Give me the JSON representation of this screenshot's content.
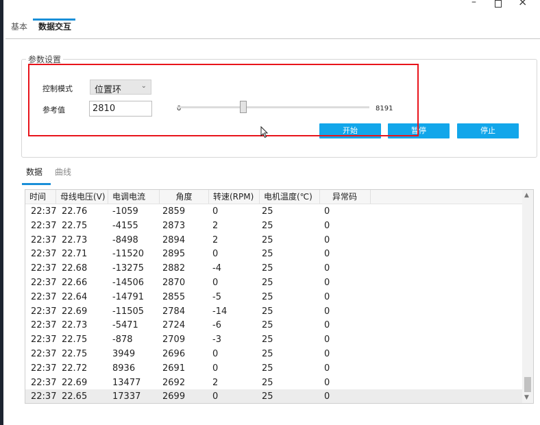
{
  "tabs": {
    "basic": "基本",
    "data_exchange": "数据交互"
  },
  "params": {
    "group_title": "参数设置",
    "control_mode_label": "控制模式",
    "control_mode_value": "位置环",
    "reference_label": "参考值",
    "reference_value": "2810",
    "slider_min": "0",
    "slider_max": "8191",
    "slider_fraction": 0.343
  },
  "buttons": {
    "start": "开始",
    "pause": "暂停",
    "stop": "停止"
  },
  "subtabs": {
    "data": "数据",
    "curve": "曲线"
  },
  "table": {
    "headers": [
      "时间",
      "母线电压(V)",
      "电调电流",
      "角度",
      "转速(RPM)",
      "电机温度(℃)",
      "异常码"
    ],
    "rows": [
      [
        "22:37",
        "22.76",
        "-1059",
        "2859",
        "0",
        "25",
        "0"
      ],
      [
        "22:37",
        "22.75",
        "-4155",
        "2873",
        "2",
        "25",
        "0"
      ],
      [
        "22:37",
        "22.73",
        "-8498",
        "2894",
        "2",
        "25",
        "0"
      ],
      [
        "22:37",
        "22.71",
        "-11520",
        "2895",
        "0",
        "25",
        "0"
      ],
      [
        "22:37",
        "22.68",
        "-13275",
        "2882",
        "-4",
        "25",
        "0"
      ],
      [
        "22:37",
        "22.66",
        "-14506",
        "2870",
        "0",
        "25",
        "0"
      ],
      [
        "22:37",
        "22.64",
        "-14791",
        "2855",
        "-5",
        "25",
        "0"
      ],
      [
        "22:37",
        "22.69",
        "-11505",
        "2784",
        "-14",
        "25",
        "0"
      ],
      [
        "22:37",
        "22.73",
        "-5471",
        "2724",
        "-6",
        "25",
        "0"
      ],
      [
        "22:37",
        "22.75",
        "-878",
        "2709",
        "-3",
        "25",
        "0"
      ],
      [
        "22:37",
        "22.75",
        "3949",
        "2696",
        "0",
        "25",
        "0"
      ],
      [
        "22:37",
        "22.72",
        "8936",
        "2691",
        "0",
        "25",
        "0"
      ],
      [
        "22:37",
        "22.69",
        "13477",
        "2692",
        "2",
        "25",
        "0"
      ],
      [
        "22:37",
        "22.65",
        "17337",
        "2699",
        "0",
        "25",
        "0"
      ]
    ]
  },
  "colors": {
    "accent": "#12a6ea",
    "highlight": "#e8131a",
    "tab_underline": "#1a8fd8"
  }
}
